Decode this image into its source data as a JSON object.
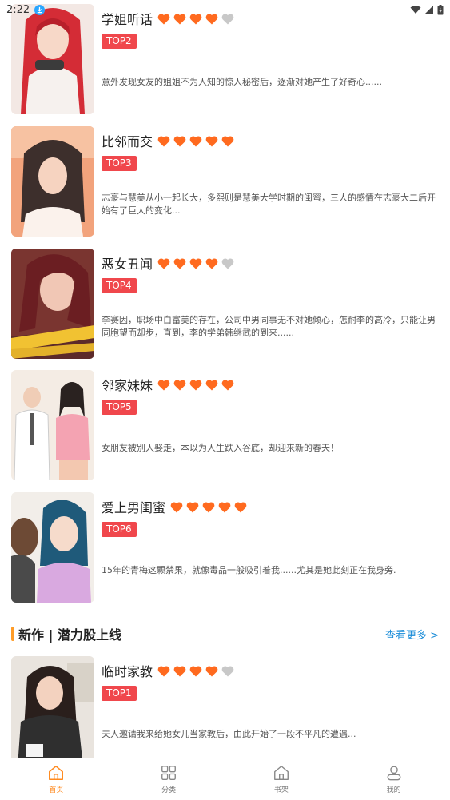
{
  "status": {
    "time": "2:22"
  },
  "colors": {
    "accent": "#ff8a1f",
    "heart_on": "#ff6a1f",
    "heart_off": "#c8c8c8",
    "rank_bg": "#f0474c",
    "more_link": "#1a8cd8"
  },
  "items": [
    {
      "title": "学姐听话",
      "rating": 4,
      "rank": "TOP2",
      "desc": "意外发现女友的姐姐不为人知的惊人秘密后，逐渐对她产生了好奇心......"
    },
    {
      "title": "比邻而交",
      "rating": 5,
      "rank": "TOP3",
      "desc": "志豪与慧美从小一起长大，多熙则是慧美大学时期的闺蜜，三人的感情在志豪大二后开始有了巨大的变化..."
    },
    {
      "title": "恶女丑闻",
      "rating": 4,
      "rank": "TOP4",
      "desc": "李赛因，职场中白富美的存在，公司中男同事无不对她倾心，怎耐李的高冷，只能让男同胞望而却步，直到，李的学弟韩继武的到来......"
    },
    {
      "title": "邻家妹妹",
      "rating": 5,
      "rank": "TOP5",
      "desc": "女朋友被别人娶走，本以为人生跌入谷底，却迎来新的春天！"
    },
    {
      "title": "爱上男闺蜜",
      "rating": 5,
      "rank": "TOP6",
      "desc": "15年的青梅这颗禁果，就像毒品一般吸引着我......尤其是她此刻正在我身旁."
    }
  ],
  "section": {
    "title": "新作 | 潜力股上线",
    "more": "查看更多 >"
  },
  "new_items": [
    {
      "title": "临时家教",
      "rating": 4,
      "rank": "TOP1",
      "desc": "夫人邀请我来给她女儿当家教后，由此开始了一段不平凡的遭遇..."
    }
  ],
  "tabs": [
    {
      "label": "首页",
      "icon": "home-icon",
      "active": true
    },
    {
      "label": "分类",
      "icon": "grid-icon",
      "active": false
    },
    {
      "label": "书架",
      "icon": "bookshelf-icon",
      "active": false
    },
    {
      "label": "我的",
      "icon": "user-icon",
      "active": false
    }
  ]
}
